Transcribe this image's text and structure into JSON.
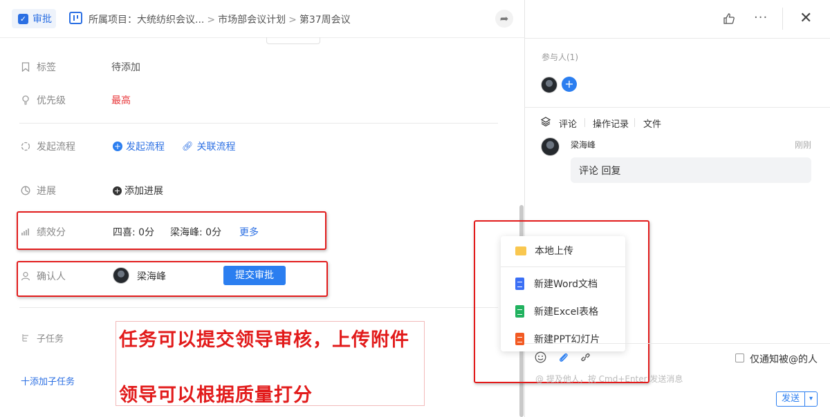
{
  "header": {
    "type_label": "审批",
    "breadcrumb": [
      "所属项目：大统纺织会议...",
      "市场部会议计划",
      "第37周会议"
    ],
    "separator": ">"
  },
  "fields": {
    "tag": {
      "label": "标签",
      "value": "待添加"
    },
    "priority": {
      "label": "优先级",
      "value": "最高"
    },
    "flow": {
      "label": "发起流程",
      "start": "发起流程",
      "link": "关联流程"
    },
    "progress": {
      "label": "进展",
      "add": "添加进展"
    },
    "performance": {
      "label": "绩效分",
      "scores": [
        "四喜: 0分",
        "梁海峰: 0分"
      ],
      "more": "更多"
    },
    "confirmer": {
      "label": "确认人",
      "name": "梁海峰",
      "submit": "提交审批"
    },
    "subtask": {
      "label": "子任务",
      "add": "十添加子任务"
    }
  },
  "annotations": {
    "line1": "任务可以提交领导审核，上传附件",
    "line2": "领导可以根据质量打分"
  },
  "right": {
    "participants_label": "参与人(1)",
    "tabs": [
      "评论",
      "操作记录",
      "文件"
    ],
    "active_tab": "评论",
    "comment": {
      "author": "梁海峰",
      "time": "刚刚",
      "text": "评论 回复"
    },
    "notify_label": "仅通知被@的人",
    "input_placeholder": "@ 提及他人，按 Cmd+Enter 发送消息",
    "send_label": "发送"
  },
  "upload_menu": {
    "items": [
      "本地上传",
      "新建Word文档",
      "新建Excel表格",
      "新建PPT幻灯片"
    ]
  },
  "colors": {
    "accent": "#2b7ef0",
    "priority_high": "#e8373a",
    "annotation": "#e21b1b"
  },
  "icons": [
    "check-square-icon",
    "project-icon",
    "share-icon",
    "bookmark-icon",
    "bulb-icon",
    "flow-icon",
    "progress-icon",
    "bar-chart-icon",
    "user-icon",
    "subtask-icon",
    "thumbs-up-icon",
    "more-icon",
    "close-icon",
    "layers-icon",
    "emoji-icon",
    "paperclip-icon",
    "link-icon",
    "folder-icon",
    "word-icon",
    "excel-icon",
    "ppt-icon"
  ]
}
